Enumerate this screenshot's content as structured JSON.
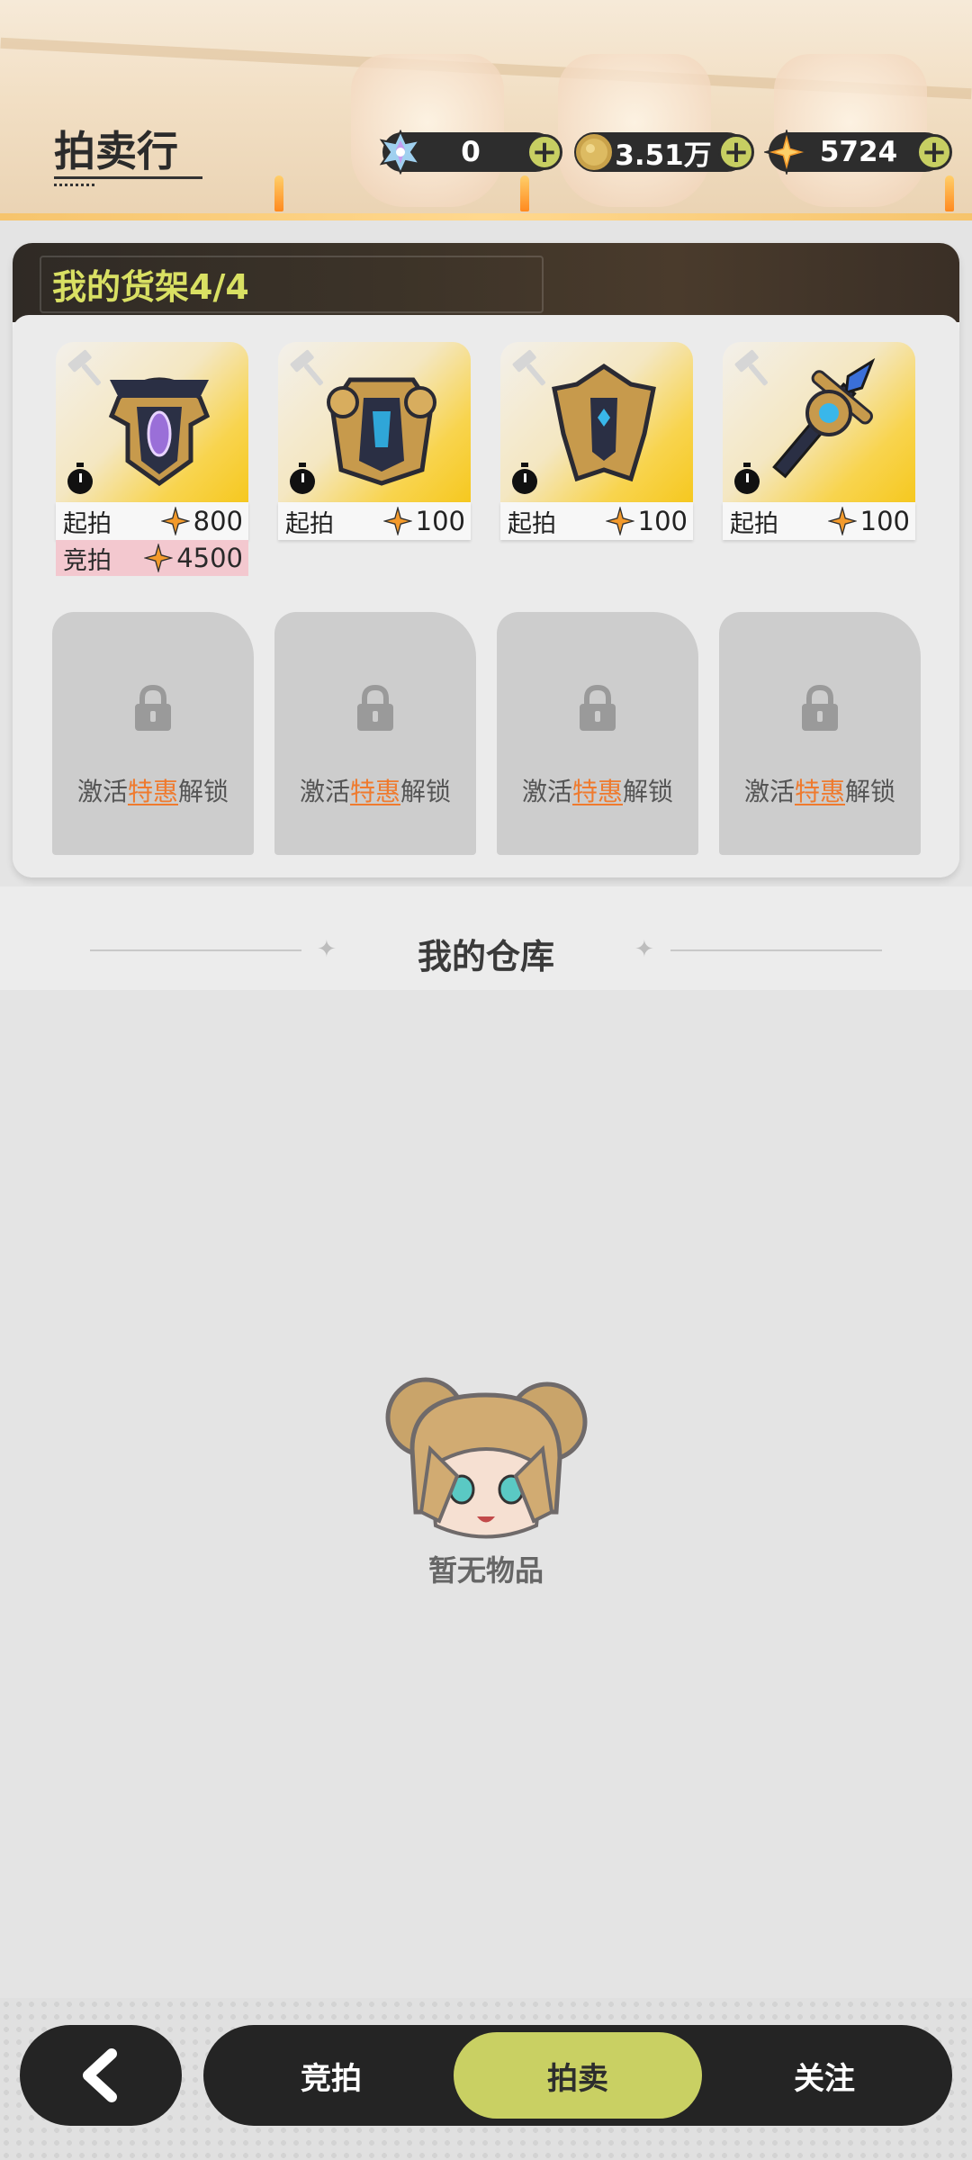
{
  "header": {
    "title": "拍卖行",
    "currencies": [
      {
        "icon": "crystal-icon",
        "value": "0"
      },
      {
        "icon": "gold-coin-icon",
        "value": "3.51万"
      },
      {
        "icon": "star-gem-icon",
        "value": "5724"
      }
    ],
    "plus_label": "+"
  },
  "shelf": {
    "title": "我的货架4/4",
    "items": [
      {
        "name": "helmet-armor-item",
        "start_label": "起拍",
        "start_price": "800",
        "bid_label": "竞拍",
        "bid_price": "4500"
      },
      {
        "name": "chest-armor-item",
        "start_label": "起拍",
        "start_price": "100"
      },
      {
        "name": "mask-helmet-item",
        "start_label": "起拍",
        "start_price": "100"
      },
      {
        "name": "sword-item",
        "start_label": "起拍",
        "start_price": "100"
      }
    ],
    "locked_slot": {
      "prefix": "激活",
      "highlight": "特惠",
      "suffix": "解锁"
    },
    "colors": {
      "accent": "#d9e063",
      "highlight": "#ef7a2e",
      "bid_bg": "#f3c8cf"
    }
  },
  "warehouse": {
    "title": "我的仓库",
    "empty_text": "暂无物品"
  },
  "nav": {
    "tabs": [
      "竞拍",
      "拍卖",
      "关注"
    ],
    "active": "拍卖",
    "accent": "#c9d063"
  }
}
